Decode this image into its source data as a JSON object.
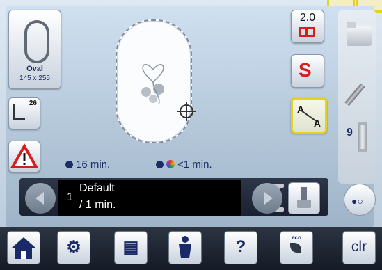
{
  "hoop": {
    "name": "Oval",
    "size": "145 x 255"
  },
  "needle_button": {
    "stitch_number": "26"
  },
  "status": {
    "total_time": "16 min.",
    "color_time": "<1 min."
  },
  "color_info": {
    "index": "1",
    "name": "Default",
    "duration": "/ 1 min."
  },
  "side_buttons": {
    "scale_value": "2.0"
  },
  "right_panel": {
    "thread_count": "9"
  },
  "bottom_bar": {
    "eco_label": "eco",
    "clr_label": "clr"
  },
  "colors": {
    "accent_yellow": "#e5d21b",
    "accent_red": "#d51e1e",
    "text_blue": "#1a2a66",
    "dark_bar": "#1a2130"
  },
  "icons": [
    "home-icon",
    "setup-icon",
    "tutorial-icon",
    "creative-guide-icon",
    "help-icon",
    "eco-icon",
    "folder-icon",
    "pencil-icon",
    "thread-spool-icon",
    "warning-icon",
    "crosshair-icon",
    "clock-icon",
    "color-palette-icon",
    "arrow-left-icon",
    "arrow-right-icon",
    "brush-icon",
    "toggle-icon"
  ]
}
